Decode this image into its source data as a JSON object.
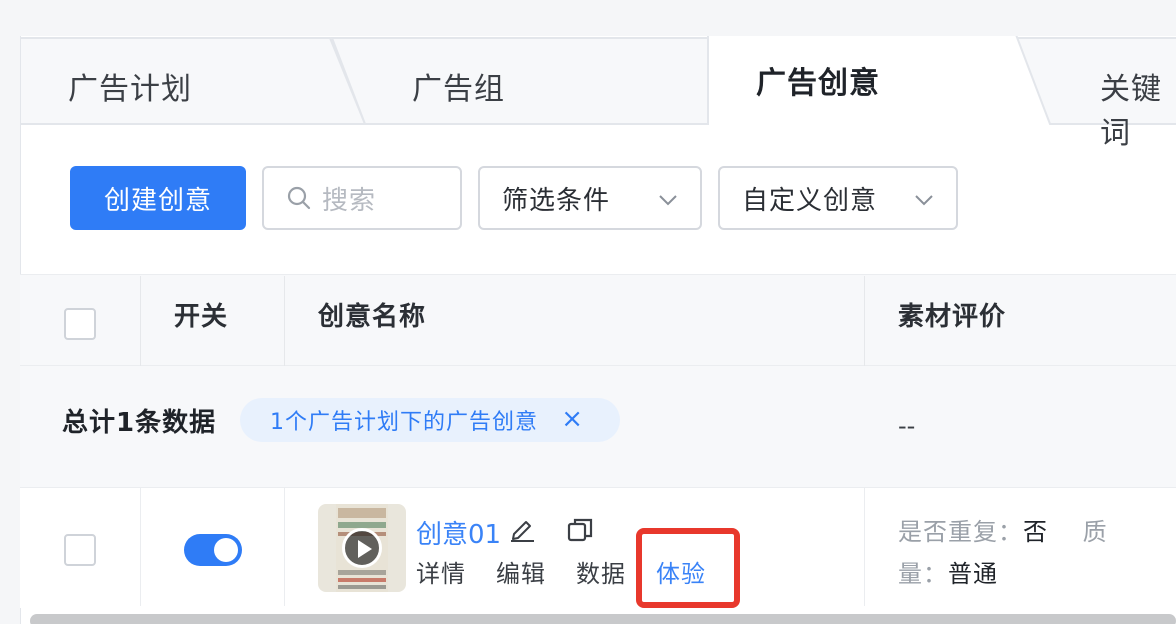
{
  "tabs": [
    {
      "label": "广告计划",
      "active": false
    },
    {
      "label": "广告组",
      "active": false
    },
    {
      "label": "广告创意",
      "active": true
    },
    {
      "label": "关键词",
      "active": false
    }
  ],
  "toolbar": {
    "create_label": "创建创意",
    "search_placeholder": "搜索",
    "filter_label": "筛选条件",
    "custom_label": "自定义创意"
  },
  "table": {
    "headers": [
      "开关",
      "创意名称",
      "素材评价"
    ],
    "summary_text": "总计1条数据",
    "filter_tag": "1个广告计划下的广告创意",
    "filter_tag_close": "×",
    "summary_eval": "--",
    "rows": [
      {
        "switch_on": true,
        "name": "创意01",
        "actions": [
          "详情",
          "编辑",
          "数据",
          "体验"
        ],
        "repeat_key": "是否重复：",
        "repeat_value": "否",
        "quality_key_1": "质",
        "quality_key_2": "量：",
        "quality_value": "普通"
      }
    ]
  },
  "colors": {
    "primary": "#2f7cf6",
    "link": "#3a83f7",
    "highlight": "#e8382c"
  },
  "icons": [
    "search-icon",
    "chevron-down-icon",
    "edit-icon",
    "copy-icon",
    "play-icon",
    "close-icon"
  ]
}
